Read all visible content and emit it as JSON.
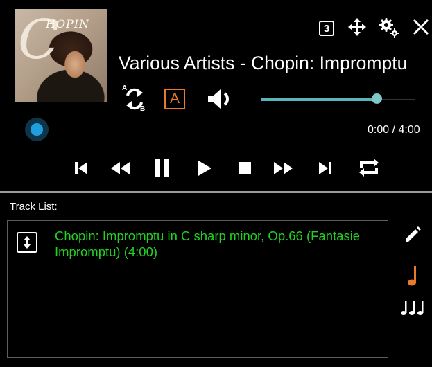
{
  "player": {
    "album_art_text": "HOPIN",
    "album_art_letter": "C",
    "title": "Various Artists - Chopin: Impromptu",
    "top_icons": [
      "widget-3-icon",
      "move-icon",
      "settings-icon",
      "close-icon"
    ],
    "widget_badge": "3",
    "ab_repeat": {
      "a": "A",
      "b": "B"
    },
    "mode_label": "A",
    "time": "0:00 / 4:00",
    "progress": 0.0,
    "volume": 0.75,
    "colors": {
      "seek": "#1f9fe0",
      "volume": "#5ab5b8",
      "mode": "#e87a2a"
    },
    "transport": [
      "previous-icon",
      "rewind-icon",
      "pause-icon",
      "play-icon",
      "stop-icon",
      "fast-forward-icon",
      "next-icon",
      "repeat-icon"
    ]
  },
  "tracklist": {
    "label": "Track List:",
    "tracks": [
      {
        "title": "Chopin: Impromptu in C sharp minor, Op.66 (Fantasie Impromptu) (4:00)"
      }
    ],
    "track_color": "#23d023",
    "side_icons": [
      "edit-icon",
      "single-note-icon",
      "multi-note-icon"
    ]
  }
}
